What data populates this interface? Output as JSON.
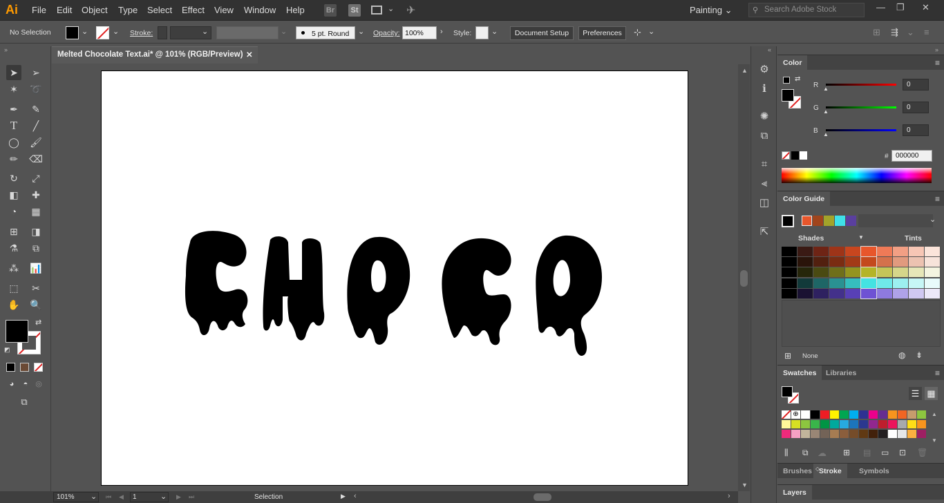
{
  "app": {
    "logo": "Ai"
  },
  "menu": [
    "File",
    "Edit",
    "Object",
    "Type",
    "Select",
    "Effect",
    "View",
    "Window",
    "Help"
  ],
  "menu_icons": {
    "bridge": "Br",
    "stock": "St"
  },
  "workspace": {
    "label": "Painting",
    "chevron": "⌄"
  },
  "search": {
    "placeholder": "Search Adobe Stock"
  },
  "window_controls": {
    "minimize": "—",
    "restore": "❐",
    "close": "✕"
  },
  "control_bar": {
    "selection_label": "No Selection",
    "stroke_label": "Stroke:",
    "brush_label": "5 pt. Round",
    "opacity_label": "Opacity:",
    "opacity_value": "100%",
    "style_label": "Style:",
    "document_setup": "Document Setup",
    "preferences": "Preferences"
  },
  "document_tab": {
    "title": "Melted Chocolate Text.ai* @ 101% (RGB/Preview)",
    "close": "✕"
  },
  "artwork": {
    "text": "CHOCO"
  },
  "status_bar": {
    "zoom": "101%",
    "page": "1",
    "tool": "Selection"
  },
  "color_panel": {
    "title": "Color",
    "channels": [
      {
        "label": "R",
        "value": "0",
        "color": "#ff0000"
      },
      {
        "label": "G",
        "value": "0",
        "color": "#00ff00"
      },
      {
        "label": "B",
        "value": "0",
        "color": "#0000ff"
      }
    ],
    "hex_label": "#",
    "hex_value": "000000"
  },
  "color_guide_panel": {
    "title": "Color Guide",
    "shades_label": "Shades",
    "tints_label": "Tints",
    "none_label": "None",
    "harmony": [
      "#e8562b",
      "#a0441c",
      "#a3a32a",
      "#3fe0e8",
      "#5a3f9e"
    ],
    "rows": [
      [
        "#000000",
        "#3a1a14",
        "#6e2415",
        "#9e3418",
        "#c8461f",
        "#e8562b",
        "#ef7a57",
        "#f29f84",
        "#f7c6b5",
        "#fbe4da"
      ],
      [
        "#000000",
        "#2a140a",
        "#52200f",
        "#7a2c12",
        "#a23a17",
        "#c4491d",
        "#d4714c",
        "#e19a7e",
        "#ecc2b1",
        "#f7e3da"
      ],
      [
        "#000000",
        "#26260a",
        "#4a4a12",
        "#6f6f1a",
        "#94941f",
        "#b4b428",
        "#c5c558",
        "#d6d68a",
        "#e6e6b8",
        "#f4f4e0"
      ],
      [
        "#000000",
        "#123a3a",
        "#1e6666",
        "#2a9292",
        "#36bebe",
        "#44e2e2",
        "#6fe9e9",
        "#9cf0f0",
        "#c6f6f6",
        "#e8fbfb"
      ],
      [
        "#000000",
        "#1a1232",
        "#2e2160",
        "#43318b",
        "#5840b6",
        "#6e52d4",
        "#8e7adf",
        "#afa2e8",
        "#d0c8f1",
        "#ece8f8"
      ]
    ]
  },
  "swatches_panel": {
    "tabs": [
      "Swatches",
      "Libraries"
    ],
    "row1": [
      "none",
      "reg",
      "#ffffff",
      "#000000",
      "#ed1c24",
      "#fff200",
      "#00a651",
      "#00aeef",
      "#2e3192",
      "#ec008c",
      "#662d91",
      "#f7941d",
      "#f26522",
      "#c69c6d",
      "#8dc63f"
    ],
    "row2": [
      "#fff799",
      "#d7df23",
      "#8dc63f",
      "#39b54a",
      "#009444",
      "#00a99d",
      "#27aae1",
      "#1c75bc",
      "#2b388f",
      "#92278f",
      "#be1e2d",
      "#ec145c",
      "#a7a9ac",
      "#ffde17",
      "#f7941d"
    ],
    "row3": [
      "#ee2a7b",
      "#f6a0c3",
      "#c2b59b",
      "#998675",
      "#736357",
      "#a67c52",
      "#8b5e3c",
      "#754c29",
      "#603913",
      "#42210b",
      "#231f20",
      "#ffffff",
      "#e6e7e8",
      "#fbb040",
      "#9e1f63"
    ]
  },
  "bottom_panels": {
    "tabs": [
      "Brushes",
      "Stroke",
      "Symbols"
    ],
    "layers": "Layers"
  }
}
